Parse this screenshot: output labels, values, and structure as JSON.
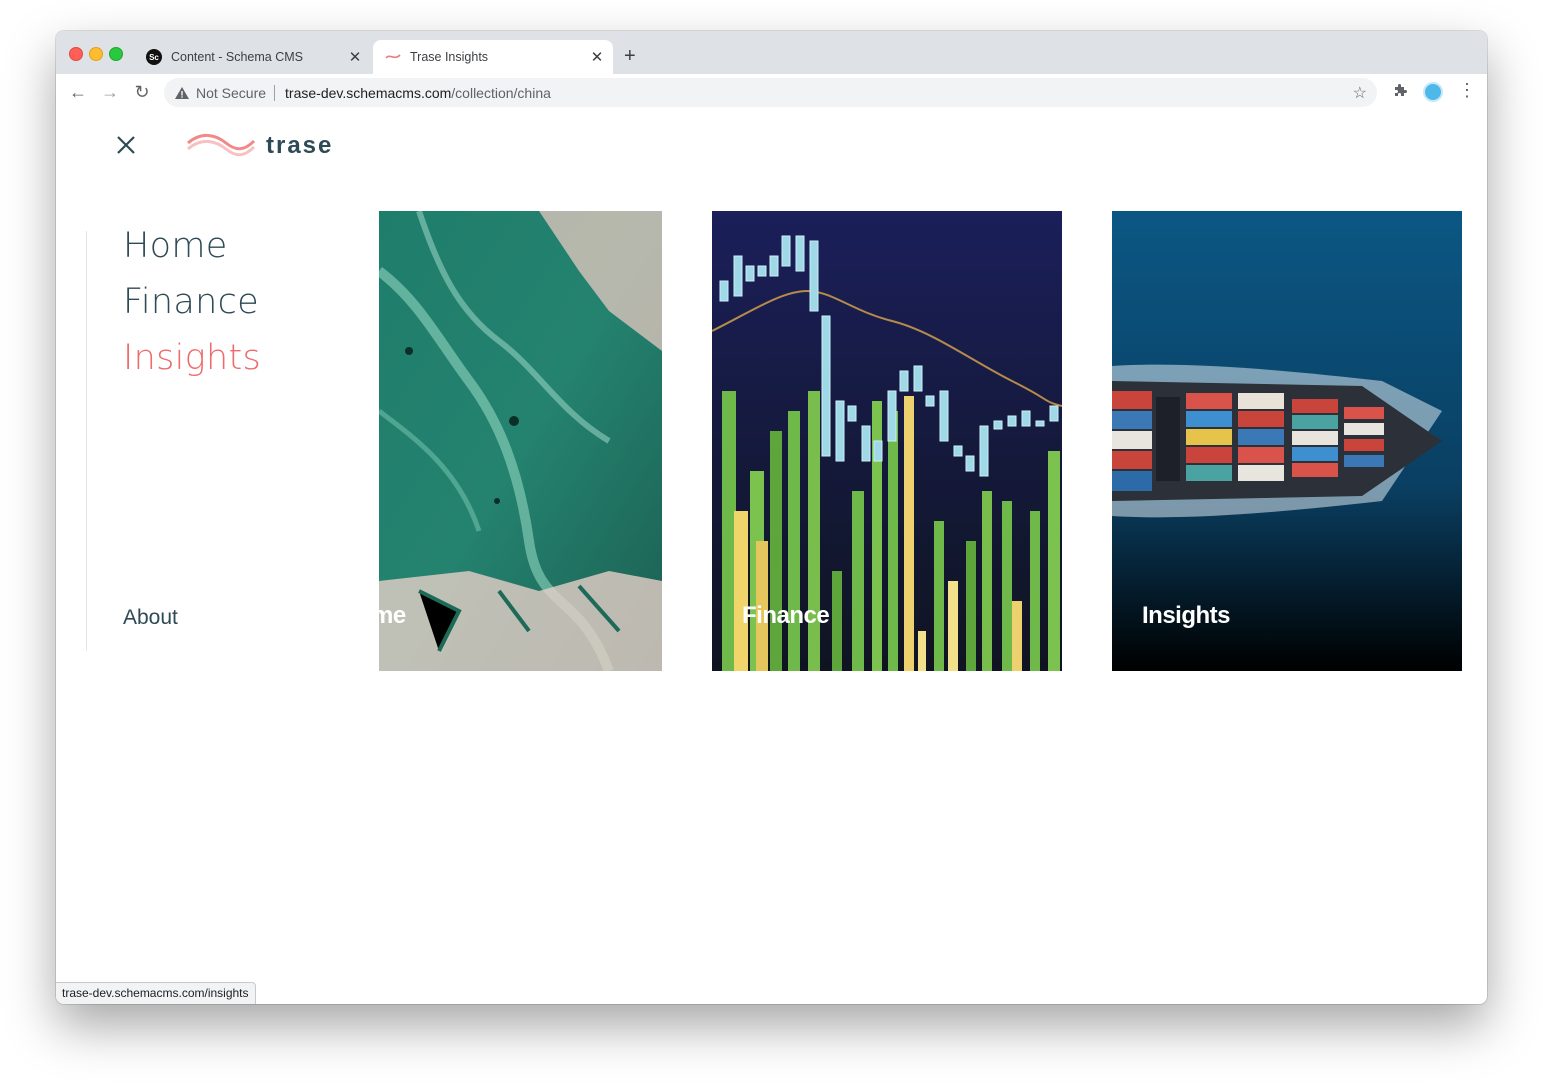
{
  "browser": {
    "tabs": [
      {
        "favicon": "schema-cms-favicon",
        "favicon_text": "Sc",
        "title": "Content - Schema CMS",
        "active": false
      },
      {
        "favicon": "trase-favicon",
        "title": "Trase Insights",
        "active": true
      }
    ],
    "address": {
      "security_label": "Not Secure",
      "host": "trase-dev.schemacms.com",
      "path": "/collection/china"
    },
    "status_url": "trase-dev.schemacms.com/insights"
  },
  "site": {
    "logo_text": "trase",
    "nav": [
      {
        "label": "Home",
        "active": false
      },
      {
        "label": "Finance",
        "active": false
      },
      {
        "label": "Insights",
        "active": true
      }
    ],
    "about_label": "About",
    "cards": [
      {
        "label": "Home",
        "image": "aerial-forest-farmland"
      },
      {
        "label": "Finance",
        "image": "stock-candlestick-chart"
      },
      {
        "label": "Insights",
        "image": "container-ship-aerial"
      }
    ],
    "colors": {
      "accent": "#ee6b6b",
      "text": "#2e4a55"
    }
  }
}
